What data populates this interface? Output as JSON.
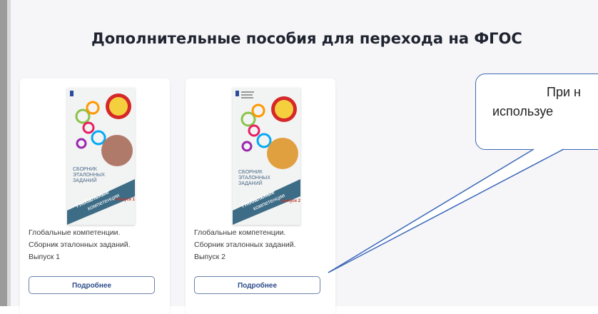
{
  "heading": "Дополнительные пособия для перехода на ФГОС",
  "books": [
    {
      "title_lines": [
        "Глобальные компетенции.",
        "Сборник эталонных заданий.",
        "Выпуск 1"
      ],
      "button_label": "Подробнее",
      "cover": {
        "series": "Глобальные компетенции",
        "subtitle": "СБОРНИК ЭТАЛОННЫХ ЗАДАНИЙ",
        "issue": "Выпуск 1",
        "accent_color": "#b07a6a"
      }
    },
    {
      "title_lines": [
        "Глобальные компетенции.",
        "Сборник эталонных заданий.",
        "Выпуск 2"
      ],
      "button_label": "Подробнее",
      "cover": {
        "series": "Глобальные компетенции",
        "subtitle": "СБОРНИК ЭТАЛОННЫХ ЗАДАНИЙ",
        "issue": "Выпуск 2",
        "accent_color": "#e0a040"
      }
    }
  ],
  "callout": {
    "lines": [
      "При н",
      "используе"
    ]
  },
  "colors": {
    "button_border": "#6b80a8",
    "callout_border": "#3c68b8",
    "cover_band": "#3d6c86"
  }
}
